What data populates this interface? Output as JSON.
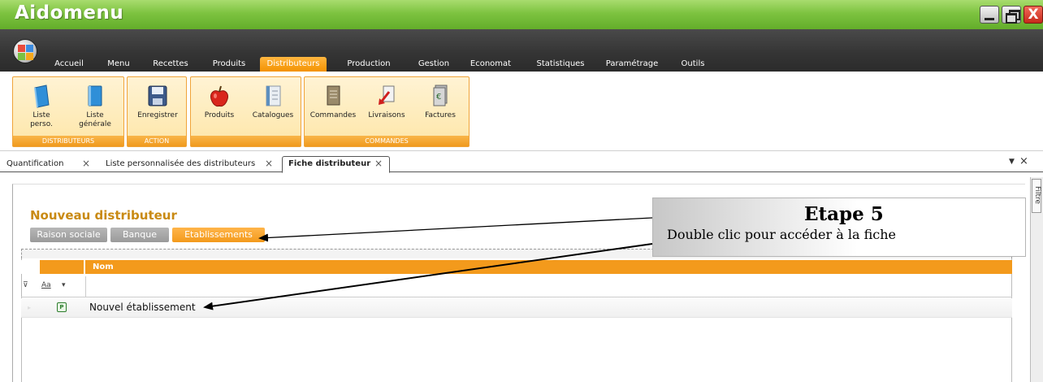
{
  "window": {
    "title": "Aidomenu",
    "close_glyph": "X"
  },
  "menu": {
    "tabs": [
      {
        "label": "Accueil"
      },
      {
        "label": "Menu"
      },
      {
        "label": "Recettes"
      },
      {
        "label": "Produits"
      },
      {
        "label": "Distributeurs",
        "active": true
      },
      {
        "label": "Production"
      },
      {
        "label": "Gestion"
      },
      {
        "label": "Economat"
      },
      {
        "label": "Statistiques"
      },
      {
        "label": "Paramétrage"
      },
      {
        "label": "Outils"
      }
    ]
  },
  "ribbon": {
    "groups": [
      {
        "label": "DISTRIBUTEURS",
        "buttons": [
          {
            "label": "Liste\nperso.",
            "icon": "book-icon"
          },
          {
            "label": "Liste\ngénérale",
            "icon": "book-icon"
          }
        ]
      },
      {
        "label": "ACTION",
        "buttons": [
          {
            "label": "Enregistrer",
            "icon": "save-icon"
          }
        ]
      },
      {
        "label": "",
        "buttons": [
          {
            "label": "Produits",
            "icon": "apple-icon"
          },
          {
            "label": "Catalogues",
            "icon": "catalog-icon"
          }
        ]
      },
      {
        "label": "COMMANDES",
        "buttons": [
          {
            "label": "Commandes",
            "icon": "order-icon"
          },
          {
            "label": "Livraisons",
            "icon": "delivery-icon"
          },
          {
            "label": "Factures",
            "icon": "invoice-icon"
          }
        ]
      }
    ]
  },
  "doc_tabs": [
    {
      "label": "Quantification"
    },
    {
      "label": "Liste personnalisée des distributeurs"
    },
    {
      "label": "Fiche distributeur",
      "active": true
    }
  ],
  "side_panel": {
    "label": "Filtre"
  },
  "page": {
    "title": "Nouveau distributeur",
    "subtabs": [
      {
        "label": "Raison sociale"
      },
      {
        "label": "Banque"
      },
      {
        "label": "Etablissements",
        "active": true
      }
    ],
    "grid": {
      "column": "Nom",
      "filter_text": "Aa",
      "rows": [
        {
          "name": "Nouvel établissement",
          "icon_letter": "P"
        }
      ]
    }
  },
  "callout": {
    "title": "Etape 5",
    "text": "Double clic pour accéder à la fiche"
  },
  "colors": {
    "title_green": "#7dc340",
    "menu_dark": "#353535",
    "accent_orange": "#f39a1c",
    "heading_gold": "#c98a13"
  }
}
